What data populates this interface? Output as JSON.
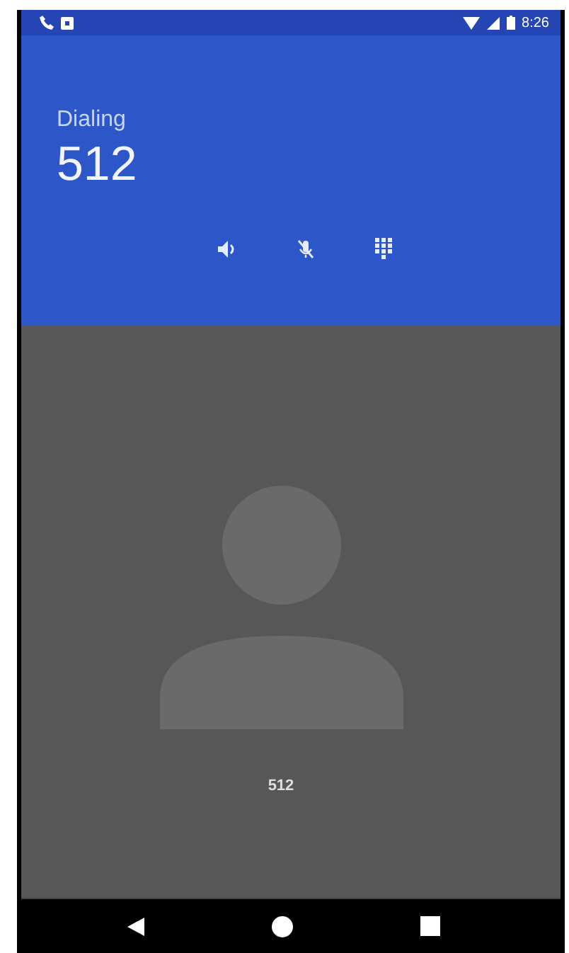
{
  "status_bar": {
    "time": "8:26"
  },
  "call": {
    "status": "Dialing",
    "number": "512"
  },
  "caller": {
    "name": "512"
  }
}
